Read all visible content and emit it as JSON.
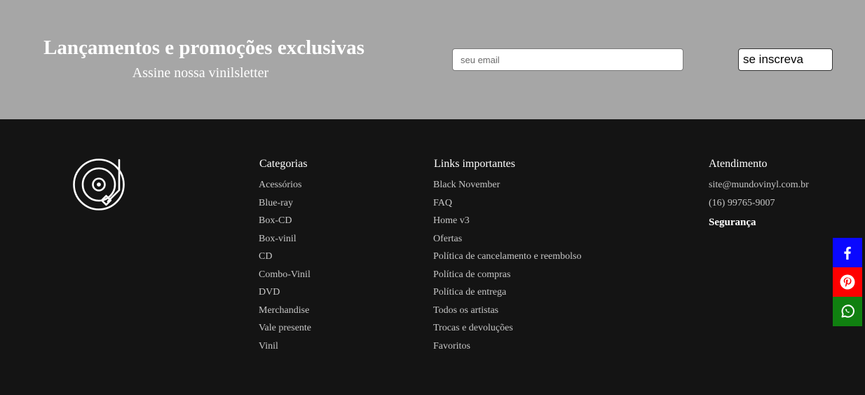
{
  "newsletter": {
    "title": "Lançamentos e promoções exclusivas",
    "subtitle": "Assine nossa vinilsletter",
    "email_placeholder": "seu email",
    "button_label": "se inscreva"
  },
  "footer": {
    "logo_icon": "vinyl-turntable-icon",
    "categories": {
      "title": "Categorias",
      "items": [
        "Acessórios",
        "Blue-ray",
        "Box-CD",
        "Box-vinil",
        "CD",
        "Combo-Vinil",
        "DVD",
        "Merchandise",
        "Vale presente",
        "Vinil"
      ]
    },
    "links": {
      "title": "Links importantes",
      "items": [
        "Black November",
        "FAQ",
        "Home v3",
        "Ofertas",
        "Política de cancelamento e reembolso",
        "Política de compras",
        "Política de entrega",
        "Todos os artistas",
        "Trocas e devoluções",
        "Favoritos"
      ]
    },
    "service": {
      "title": "Atendimento",
      "email": "site@mundovinyl.com.br",
      "phone": "(16) 99765-9007",
      "security_title": "Segurança"
    }
  },
  "share": {
    "buttons": [
      {
        "icon": "facebook-icon",
        "color": "#0a08ff"
      },
      {
        "icon": "pinterest-icon",
        "color": "#ff0000"
      },
      {
        "icon": "whatsapp-icon",
        "color": "#108010"
      }
    ]
  },
  "colors": {
    "newsletter_bg": "#a6a6a6",
    "footer_bg": "#141414"
  }
}
